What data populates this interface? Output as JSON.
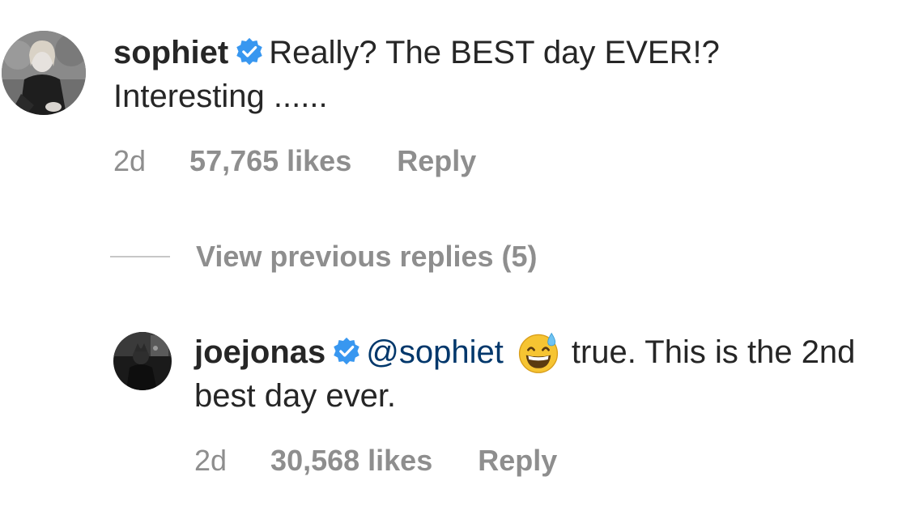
{
  "top_comment": {
    "username": "sophiet",
    "text": "Really? The BEST day EVER!? Interesting ......",
    "time": "2d",
    "likes": "57,765 likes",
    "reply_label": "Reply"
  },
  "view_previous": {
    "label": "View previous replies (5)"
  },
  "reply_comment": {
    "username": "joejonas",
    "mention": "@sophiet",
    "text": "true. This is the 2nd best day ever.",
    "time": "2d",
    "likes": "30,568 likes",
    "reply_label": "Reply"
  },
  "icons": {
    "verified": "verified-badge-icon",
    "emoji": "grinning-sweat-emoji"
  },
  "colors": {
    "text": "#262626",
    "muted": "#8e8e8e",
    "mention": "#00376b",
    "verified": "#3897f0"
  }
}
